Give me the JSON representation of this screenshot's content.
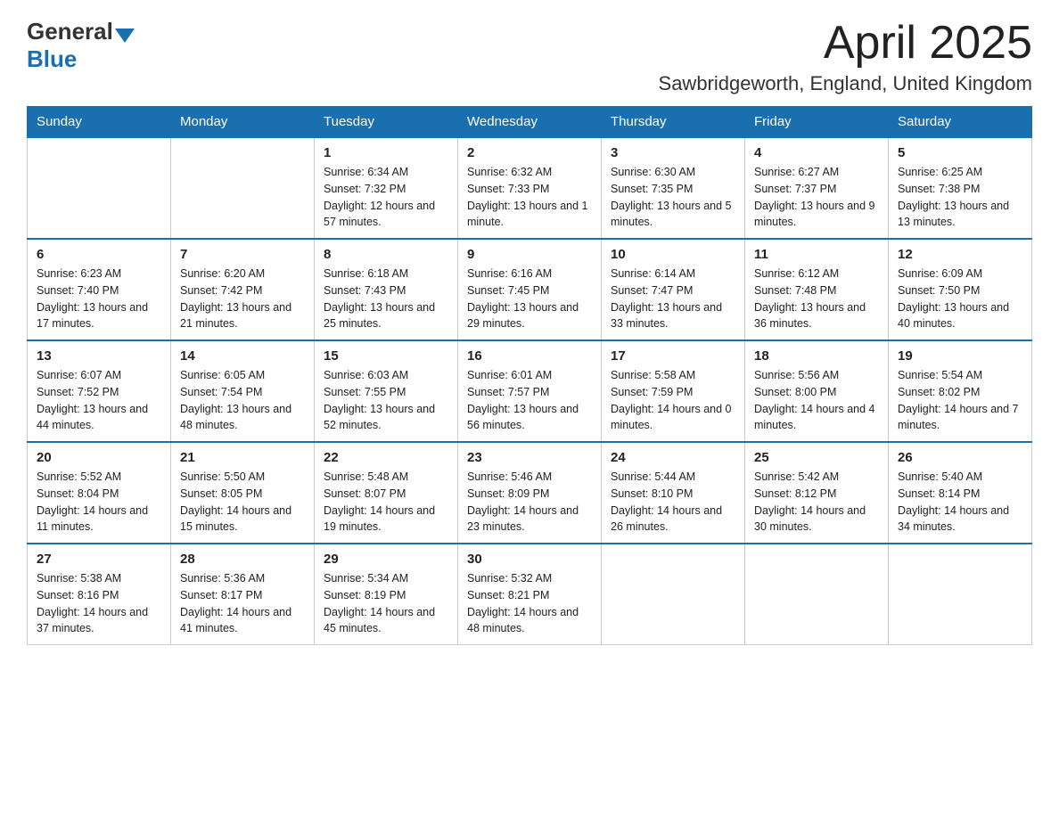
{
  "header": {
    "logo_general": "General",
    "logo_blue": "Blue",
    "month_title": "April 2025",
    "location": "Sawbridgeworth, England, United Kingdom"
  },
  "days_of_week": [
    "Sunday",
    "Monday",
    "Tuesday",
    "Wednesday",
    "Thursday",
    "Friday",
    "Saturday"
  ],
  "weeks": [
    [
      {
        "day": "",
        "sunrise": "",
        "sunset": "",
        "daylight": ""
      },
      {
        "day": "",
        "sunrise": "",
        "sunset": "",
        "daylight": ""
      },
      {
        "day": "1",
        "sunrise": "Sunrise: 6:34 AM",
        "sunset": "Sunset: 7:32 PM",
        "daylight": "Daylight: 12 hours and 57 minutes."
      },
      {
        "day": "2",
        "sunrise": "Sunrise: 6:32 AM",
        "sunset": "Sunset: 7:33 PM",
        "daylight": "Daylight: 13 hours and 1 minute."
      },
      {
        "day": "3",
        "sunrise": "Sunrise: 6:30 AM",
        "sunset": "Sunset: 7:35 PM",
        "daylight": "Daylight: 13 hours and 5 minutes."
      },
      {
        "day": "4",
        "sunrise": "Sunrise: 6:27 AM",
        "sunset": "Sunset: 7:37 PM",
        "daylight": "Daylight: 13 hours and 9 minutes."
      },
      {
        "day": "5",
        "sunrise": "Sunrise: 6:25 AM",
        "sunset": "Sunset: 7:38 PM",
        "daylight": "Daylight: 13 hours and 13 minutes."
      }
    ],
    [
      {
        "day": "6",
        "sunrise": "Sunrise: 6:23 AM",
        "sunset": "Sunset: 7:40 PM",
        "daylight": "Daylight: 13 hours and 17 minutes."
      },
      {
        "day": "7",
        "sunrise": "Sunrise: 6:20 AM",
        "sunset": "Sunset: 7:42 PM",
        "daylight": "Daylight: 13 hours and 21 minutes."
      },
      {
        "day": "8",
        "sunrise": "Sunrise: 6:18 AM",
        "sunset": "Sunset: 7:43 PM",
        "daylight": "Daylight: 13 hours and 25 minutes."
      },
      {
        "day": "9",
        "sunrise": "Sunrise: 6:16 AM",
        "sunset": "Sunset: 7:45 PM",
        "daylight": "Daylight: 13 hours and 29 minutes."
      },
      {
        "day": "10",
        "sunrise": "Sunrise: 6:14 AM",
        "sunset": "Sunset: 7:47 PM",
        "daylight": "Daylight: 13 hours and 33 minutes."
      },
      {
        "day": "11",
        "sunrise": "Sunrise: 6:12 AM",
        "sunset": "Sunset: 7:48 PM",
        "daylight": "Daylight: 13 hours and 36 minutes."
      },
      {
        "day": "12",
        "sunrise": "Sunrise: 6:09 AM",
        "sunset": "Sunset: 7:50 PM",
        "daylight": "Daylight: 13 hours and 40 minutes."
      }
    ],
    [
      {
        "day": "13",
        "sunrise": "Sunrise: 6:07 AM",
        "sunset": "Sunset: 7:52 PM",
        "daylight": "Daylight: 13 hours and 44 minutes."
      },
      {
        "day": "14",
        "sunrise": "Sunrise: 6:05 AM",
        "sunset": "Sunset: 7:54 PM",
        "daylight": "Daylight: 13 hours and 48 minutes."
      },
      {
        "day": "15",
        "sunrise": "Sunrise: 6:03 AM",
        "sunset": "Sunset: 7:55 PM",
        "daylight": "Daylight: 13 hours and 52 minutes."
      },
      {
        "day": "16",
        "sunrise": "Sunrise: 6:01 AM",
        "sunset": "Sunset: 7:57 PM",
        "daylight": "Daylight: 13 hours and 56 minutes."
      },
      {
        "day": "17",
        "sunrise": "Sunrise: 5:58 AM",
        "sunset": "Sunset: 7:59 PM",
        "daylight": "Daylight: 14 hours and 0 minutes."
      },
      {
        "day": "18",
        "sunrise": "Sunrise: 5:56 AM",
        "sunset": "Sunset: 8:00 PM",
        "daylight": "Daylight: 14 hours and 4 minutes."
      },
      {
        "day": "19",
        "sunrise": "Sunrise: 5:54 AM",
        "sunset": "Sunset: 8:02 PM",
        "daylight": "Daylight: 14 hours and 7 minutes."
      }
    ],
    [
      {
        "day": "20",
        "sunrise": "Sunrise: 5:52 AM",
        "sunset": "Sunset: 8:04 PM",
        "daylight": "Daylight: 14 hours and 11 minutes."
      },
      {
        "day": "21",
        "sunrise": "Sunrise: 5:50 AM",
        "sunset": "Sunset: 8:05 PM",
        "daylight": "Daylight: 14 hours and 15 minutes."
      },
      {
        "day": "22",
        "sunrise": "Sunrise: 5:48 AM",
        "sunset": "Sunset: 8:07 PM",
        "daylight": "Daylight: 14 hours and 19 minutes."
      },
      {
        "day": "23",
        "sunrise": "Sunrise: 5:46 AM",
        "sunset": "Sunset: 8:09 PM",
        "daylight": "Daylight: 14 hours and 23 minutes."
      },
      {
        "day": "24",
        "sunrise": "Sunrise: 5:44 AM",
        "sunset": "Sunset: 8:10 PM",
        "daylight": "Daylight: 14 hours and 26 minutes."
      },
      {
        "day": "25",
        "sunrise": "Sunrise: 5:42 AM",
        "sunset": "Sunset: 8:12 PM",
        "daylight": "Daylight: 14 hours and 30 minutes."
      },
      {
        "day": "26",
        "sunrise": "Sunrise: 5:40 AM",
        "sunset": "Sunset: 8:14 PM",
        "daylight": "Daylight: 14 hours and 34 minutes."
      }
    ],
    [
      {
        "day": "27",
        "sunrise": "Sunrise: 5:38 AM",
        "sunset": "Sunset: 8:16 PM",
        "daylight": "Daylight: 14 hours and 37 minutes."
      },
      {
        "day": "28",
        "sunrise": "Sunrise: 5:36 AM",
        "sunset": "Sunset: 8:17 PM",
        "daylight": "Daylight: 14 hours and 41 minutes."
      },
      {
        "day": "29",
        "sunrise": "Sunrise: 5:34 AM",
        "sunset": "Sunset: 8:19 PM",
        "daylight": "Daylight: 14 hours and 45 minutes."
      },
      {
        "day": "30",
        "sunrise": "Sunrise: 5:32 AM",
        "sunset": "Sunset: 8:21 PM",
        "daylight": "Daylight: 14 hours and 48 minutes."
      },
      {
        "day": "",
        "sunrise": "",
        "sunset": "",
        "daylight": ""
      },
      {
        "day": "",
        "sunrise": "",
        "sunset": "",
        "daylight": ""
      },
      {
        "day": "",
        "sunrise": "",
        "sunset": "",
        "daylight": ""
      }
    ]
  ]
}
